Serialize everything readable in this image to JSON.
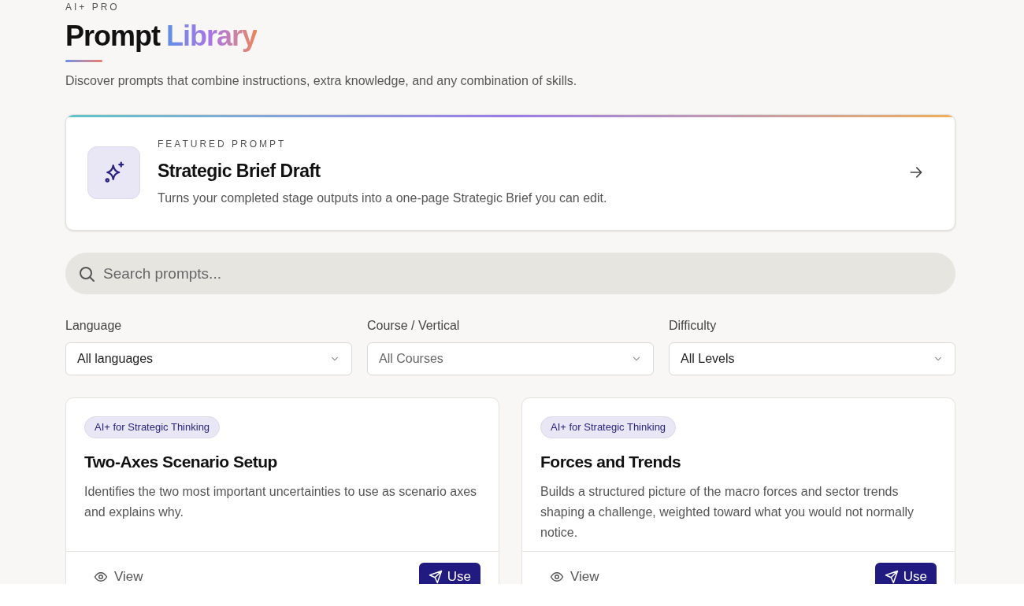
{
  "header": {
    "eyebrow": "AI+ PRO",
    "title_plain": "Prompt",
    "title_accent": "Library",
    "subtitle": "Discover prompts that combine instructions, extra knowledge, and any combination of skills."
  },
  "featured": {
    "eyebrow": "FEATURED PROMPT",
    "title": "Strategic Brief Draft",
    "description": "Turns your completed stage outputs into a one-page Strategic Brief you can edit."
  },
  "search": {
    "placeholder": "Search prompts..."
  },
  "filters": [
    {
      "label": "Language",
      "value": "All languages",
      "muted": false
    },
    {
      "label": "Course / Vertical",
      "value": "All Courses",
      "muted": true
    },
    {
      "label": "Difficulty",
      "value": "All Levels",
      "muted": false
    }
  ],
  "cards": [
    {
      "tag": "AI+ for Strategic Thinking",
      "title": "Two-Axes Scenario Setup",
      "description": "Identifies the two most important uncertainties to use as scenario axes and explains why.",
      "view_label": "View",
      "use_label": "Use"
    },
    {
      "tag": "AI+ for Strategic Thinking",
      "title": "Forces and Trends",
      "description": "Builds a structured picture of the macro forces and sector trends shaping a challenge, weighted toward what you would not normally notice.",
      "view_label": "View",
      "use_label": "Use"
    }
  ]
}
